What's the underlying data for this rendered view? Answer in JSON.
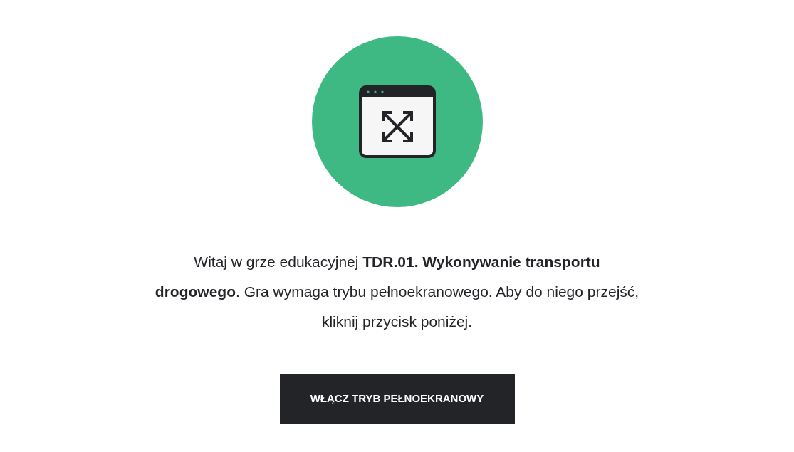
{
  "message": "Witaj w grze edukacyjnej **TDR.01. Wykonywanie transportu drogowego**. Gra wymaga trybu pełnoekranowego. Aby do niego przejść, kliknij przycisk poniżej.",
  "button": "WŁĄCZ TRYB PEŁNOEKRANOWY"
}
